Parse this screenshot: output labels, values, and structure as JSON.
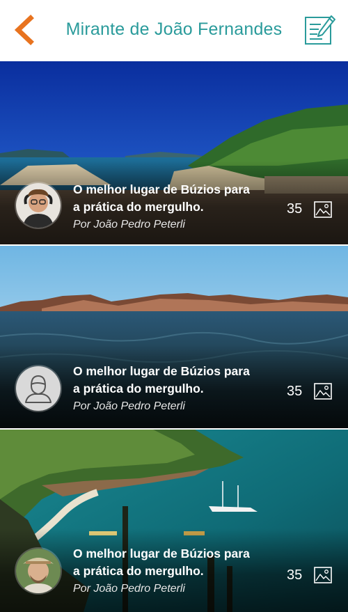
{
  "header": {
    "title": "Mirante de João Fernandes",
    "back_icon": "chevron-left-icon",
    "compose_icon": "compose-icon",
    "accent_color": "#2a9b9b",
    "back_color": "#e8731f"
  },
  "posts": [
    {
      "title_line1": "O melhor lugar de Búzios para",
      "title_line2": "a prática do mergulho.",
      "author": "Por João Pedro Peterli",
      "photo_count": "35",
      "avatar": "photo"
    },
    {
      "title_line1": "O melhor lugar de Búzios para",
      "title_line2": "a prática do mergulho.",
      "author": "Por João Pedro Peterli",
      "photo_count": "35",
      "avatar": "placeholder-user-icon"
    },
    {
      "title_line1": "O melhor lugar de Búzios para",
      "title_line2": "a prática do mergulho.",
      "author": "Por João Pedro Peterli",
      "photo_count": "35",
      "avatar": "photo"
    }
  ]
}
